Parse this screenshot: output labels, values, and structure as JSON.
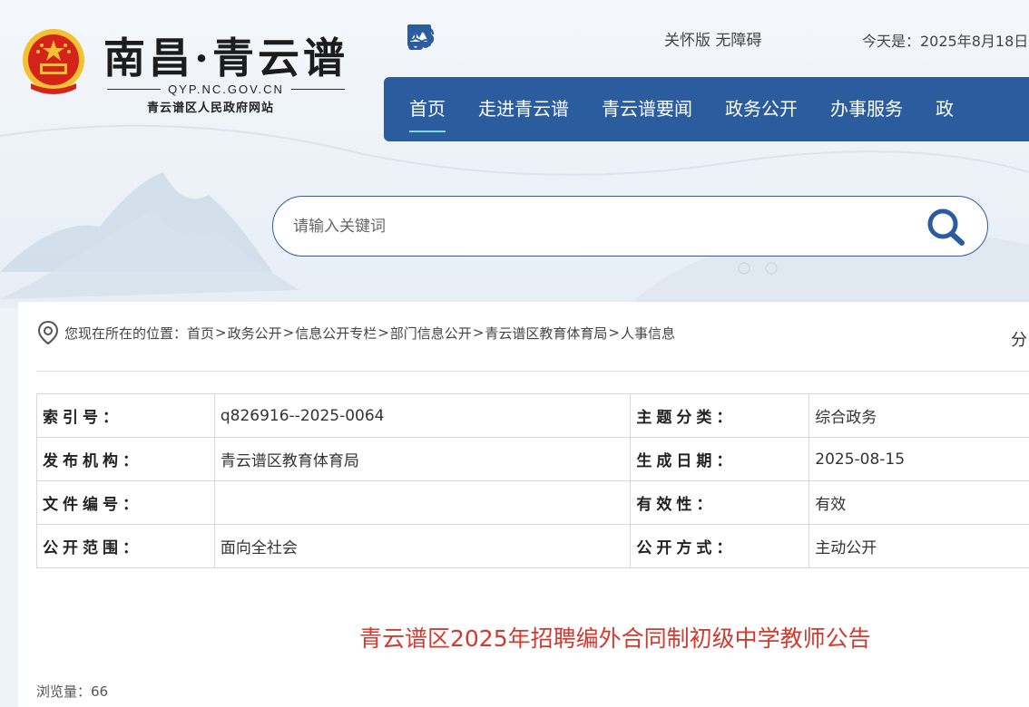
{
  "header": {
    "site_title": "南昌·青云谱",
    "domain": "QYP.NC.GOV.CN",
    "subtitle": "青云谱区人民政府网站",
    "icons": [
      "wechat-icon",
      "weibo-icon",
      "mobile-icon",
      "app-icon",
      "share-icon"
    ],
    "care_label": "关怀版 无障碍",
    "date_text": "今天是：2025年8月18日"
  },
  "nav": {
    "items": [
      {
        "label": "首页",
        "active": true
      },
      {
        "label": "走进青云谱"
      },
      {
        "label": "青云谱要闻"
      },
      {
        "label": "政务公开"
      },
      {
        "label": "办事服务"
      },
      {
        "label": "政"
      }
    ]
  },
  "search": {
    "placeholder": "请输入关键词"
  },
  "breadcrumb": {
    "prefix": "您现在所在的位置：",
    "items": [
      "首页",
      "政务公开",
      "信息公开专栏",
      "部门信息公开",
      "青云谱区教育体育局",
      "人事信息"
    ],
    "separator": ">"
  },
  "share_label": "分",
  "meta_table": {
    "rows": [
      {
        "k1": "索引号：",
        "v1": "q826916--2025-0064",
        "k2": "主题分类：",
        "v2": "综合政务"
      },
      {
        "k1": "发布机构：",
        "v1": "青云谱区教育体育局",
        "k2": "生成日期：",
        "v2": "2025-08-15"
      },
      {
        "k1": "文件编号：",
        "v1": "",
        "k2": "有效性：",
        "v2": "有效"
      },
      {
        "k1": "公开范围：",
        "v1": "面向全社会",
        "k2": "公开方式：",
        "v2": "主动公开"
      }
    ]
  },
  "article": {
    "title": "青云谱区2025年招聘编外合同制初级中学教师公告",
    "views_label": "浏览量：",
    "views": "66"
  },
  "colors": {
    "nav_bg": "#2b5c9e",
    "title_red": "#d23a2f",
    "emblem_red": "#d4231b",
    "emblem_gold": "#f2c230"
  }
}
